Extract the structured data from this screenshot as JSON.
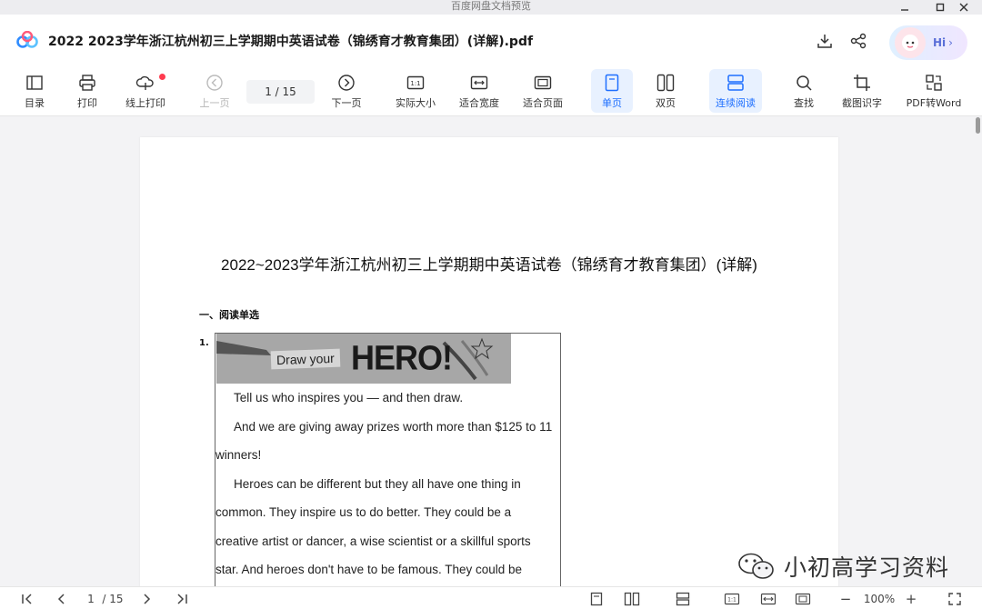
{
  "os": {
    "title": "百度网盘文档预览"
  },
  "header": {
    "doc_title": "2022 2023学年浙江杭州初三上学期期中英语试卷（锦绣育才教育集团）(详解).pdf",
    "avatar_label": "Hi",
    "icons": [
      "download-icon",
      "share-icon"
    ]
  },
  "toolbar": {
    "toc": "目录",
    "print": "打印",
    "online_print": "线上打印",
    "prev": "上一页",
    "page_indicator": "1 / 15",
    "next": "下一页",
    "actual_size": "实际大小",
    "fit_width": "适合宽度",
    "fit_page": "适合页面",
    "single_page": "单页",
    "double_page": "双页",
    "continuous": "连续阅读",
    "search": "查找",
    "ocr": "截图识字",
    "pdf_to_word": "PDF转Word",
    "accent": "#1e6fff"
  },
  "document": {
    "title": "2022~2023学年浙江杭州初三上学期期中英语试卷（锦绣育才教育集团）(详解)",
    "section": "一、阅读单选",
    "question_number": "1.",
    "image_text": {
      "draw": "Draw your",
      "hero": "HERO!"
    },
    "passage": [
      "Tell us who inspires you — and then draw.",
      "And we are giving away prizes worth more than $125 to 11",
      "winners!",
      "Heroes can be different but they all have one thing in",
      "common. They inspire us to do better. They could be a",
      "creative artist or dancer, a wise scientist or a skillful sports",
      "star. And heroes don't have to be famous. They could be"
    ]
  },
  "watermark": {
    "text": "小初高学习资料"
  },
  "bottom": {
    "page_current": "1",
    "page_total": "/ 15",
    "zoom": "100%",
    "zoom_in": "+",
    "zoom_out": "−"
  }
}
